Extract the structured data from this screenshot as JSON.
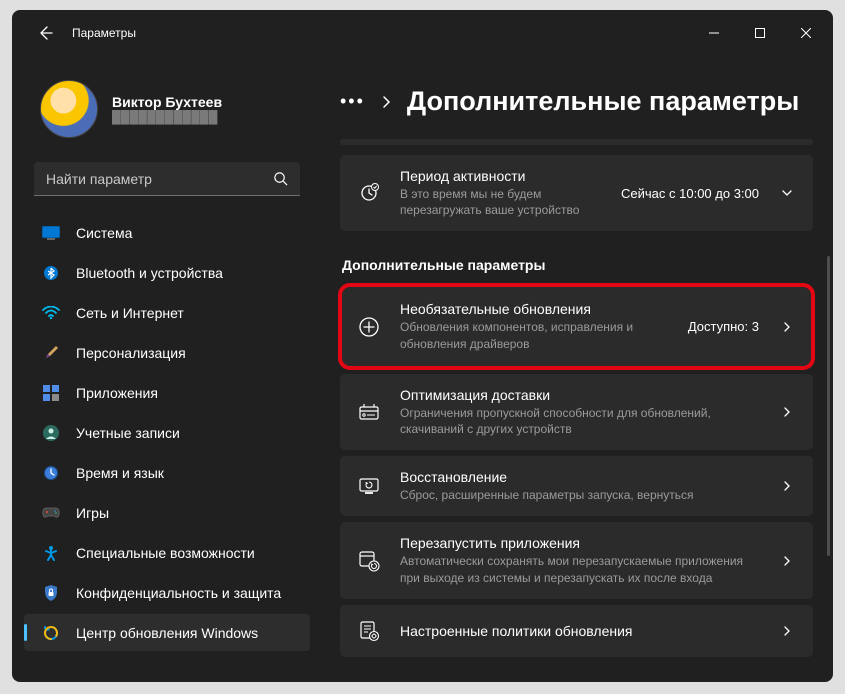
{
  "window": {
    "title": "Параметры"
  },
  "profile": {
    "name": "Виктор Бухтеев",
    "email_masked": "████████████"
  },
  "search": {
    "placeholder": "Найти параметр"
  },
  "sidebar": {
    "items": [
      {
        "label": "Система",
        "icon": "system"
      },
      {
        "label": "Bluetooth и устройства",
        "icon": "bluetooth"
      },
      {
        "label": "Сеть и Интернет",
        "icon": "wifi"
      },
      {
        "label": "Персонализация",
        "icon": "brush"
      },
      {
        "label": "Приложения",
        "icon": "apps"
      },
      {
        "label": "Учетные записи",
        "icon": "account"
      },
      {
        "label": "Время и язык",
        "icon": "time"
      },
      {
        "label": "Игры",
        "icon": "games"
      },
      {
        "label": "Специальные возможности",
        "icon": "accessibility"
      },
      {
        "label": "Конфиденциальность и защита",
        "icon": "privacy"
      },
      {
        "label": "Центр обновления Windows",
        "icon": "update",
        "active": true
      }
    ]
  },
  "breadcrumb": {
    "title": "Дополнительные параметры"
  },
  "cards": {
    "activity": {
      "title": "Период активности",
      "sub": "В это время мы не будем перезагружать ваше устройство",
      "value": "Сейчас с 10:00 до 3:00"
    },
    "section_header": "Дополнительные параметры",
    "optional": {
      "title": "Необязательные обновления",
      "sub": "Обновления компонентов, исправления и обновления драйверов",
      "value": "Доступно: 3"
    },
    "delivery": {
      "title": "Оптимизация доставки",
      "sub": "Ограничения пропускной способности для обновлений, скачиваний с других устройств"
    },
    "recovery": {
      "title": "Восстановление",
      "sub": "Сброс, расширенные параметры запуска, вернуться"
    },
    "restart_apps": {
      "title": "Перезапустить приложения",
      "sub": "Автоматически сохранять мои перезапускаемые приложения при выходе из системы и перезапускать их после входа"
    },
    "policies": {
      "title": "Настроенные политики обновления"
    }
  }
}
